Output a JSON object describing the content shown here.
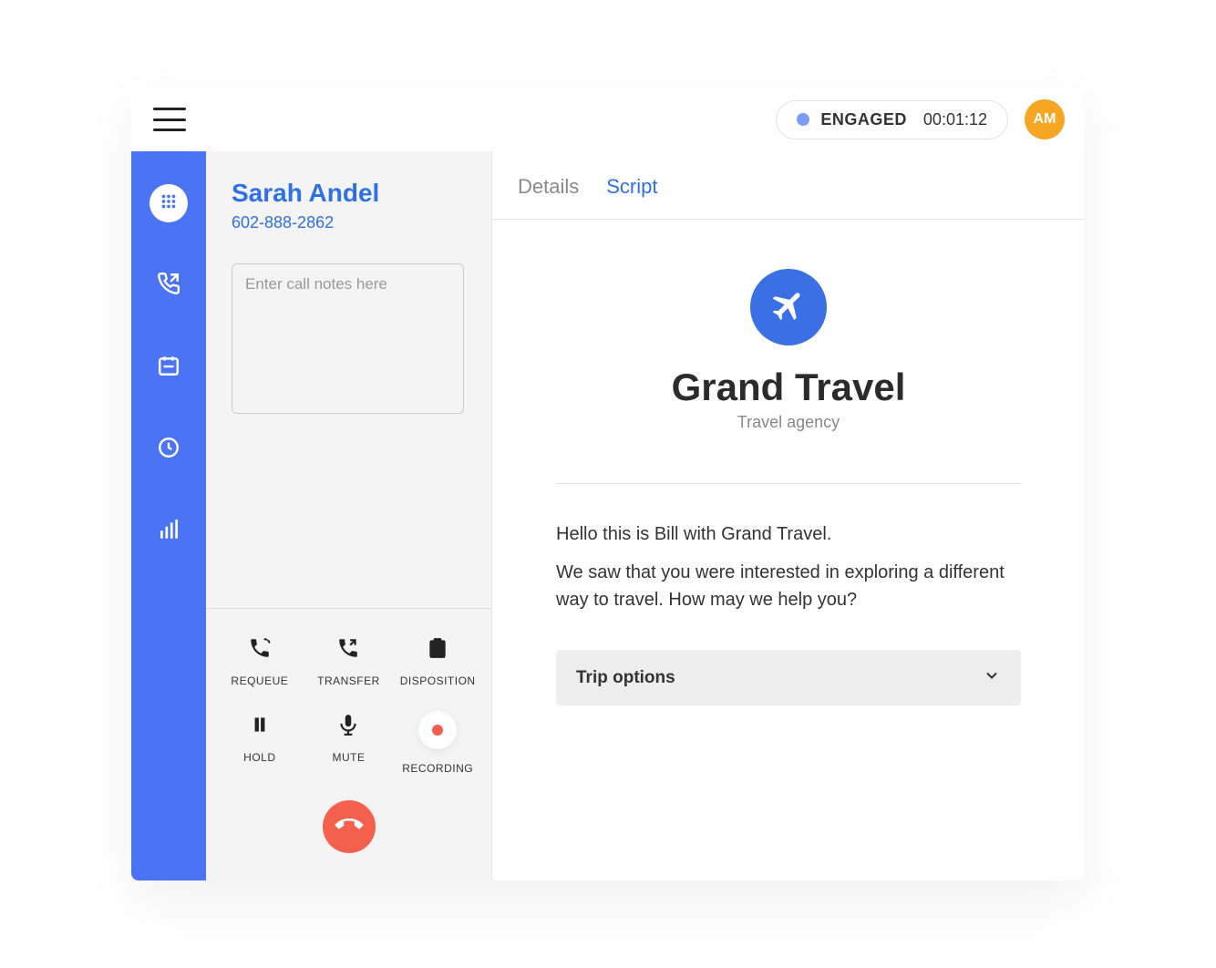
{
  "header": {
    "status_label": "ENGAGED",
    "status_timer": "00:01:12",
    "avatar_initials": "AM",
    "status_dot_color": "#7c9cf5",
    "avatar_color": "#f5a623"
  },
  "sidebar": {
    "items": [
      {
        "name": "dialpad",
        "icon": "dialpad-icon",
        "active": true
      },
      {
        "name": "outgoing-call",
        "icon": "phone-out-icon",
        "active": false
      },
      {
        "name": "calendar",
        "icon": "calendar-icon",
        "active": false
      },
      {
        "name": "clock",
        "icon": "clock-icon",
        "active": false
      },
      {
        "name": "stats",
        "icon": "bar-chart-icon",
        "active": false
      }
    ]
  },
  "call": {
    "caller_name": "Sarah Andel",
    "caller_phone": "602-888-2862",
    "notes_placeholder": "Enter call notes here",
    "controls": {
      "requeue": "REQUEUE",
      "transfer": "TRANSFER",
      "disposition": "DISPOSITION",
      "hold": "HOLD",
      "mute": "MUTE",
      "recording": "RECORDING"
    }
  },
  "tabs": {
    "details": "Details",
    "script": "Script",
    "active": "script"
  },
  "script": {
    "company_name": "Grand Travel",
    "company_type": "Travel agency",
    "greeting": "Hello this is Bill with Grand Travel.",
    "followup": "We saw that you were interested in exploring a different way to travel. How may we help you?",
    "accordion_title": "Trip options"
  },
  "colors": {
    "primary": "#4a74f4",
    "link": "#2f6fe7",
    "danger": "#f3614e"
  }
}
